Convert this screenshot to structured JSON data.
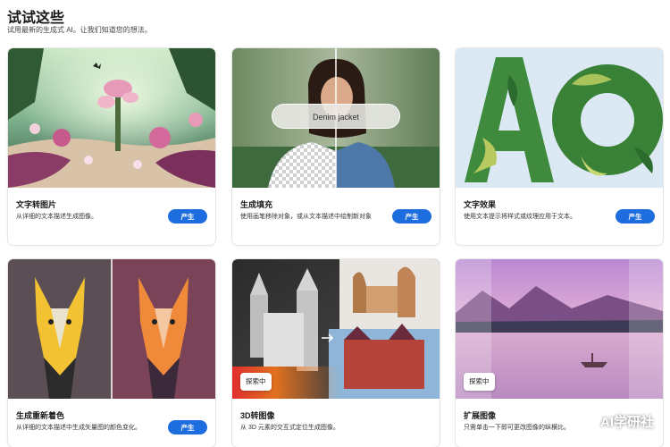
{
  "page": {
    "title": "试试这些",
    "subtitle": "试用最新的生成式 AI。让我们知道您的想法。"
  },
  "cards": [
    {
      "title": "文字转图片",
      "desc": "从详细的文本描述生成图像。",
      "button": "产生"
    },
    {
      "title": "生成填充",
      "desc": "使用画笔移除对象，或从文本描述中绘制新对象",
      "button": "产生",
      "overlay_text": "Denim jacket"
    },
    {
      "title": "文字效果",
      "desc": "使用文本提示将样式或纹理应用于文本。",
      "button": "产生",
      "art_text": "AO"
    },
    {
      "title": "生成重新着色",
      "desc": "从详细的文本描述中生成矢量图的颜色变化。",
      "button": "产生"
    },
    {
      "title": "3D转图像",
      "desc": "从 3D 元素的交互式定位生成图像。",
      "badge": "探索中"
    },
    {
      "title": "扩展图像",
      "desc": "只需单击一下即可更改图像的纵横比。",
      "badge": "探索中"
    }
  ],
  "watermark": {
    "text": "AI学研社",
    "icon": "wechat-icon"
  },
  "colors": {
    "accent": "#1e6dde",
    "background": "#ffffff"
  }
}
